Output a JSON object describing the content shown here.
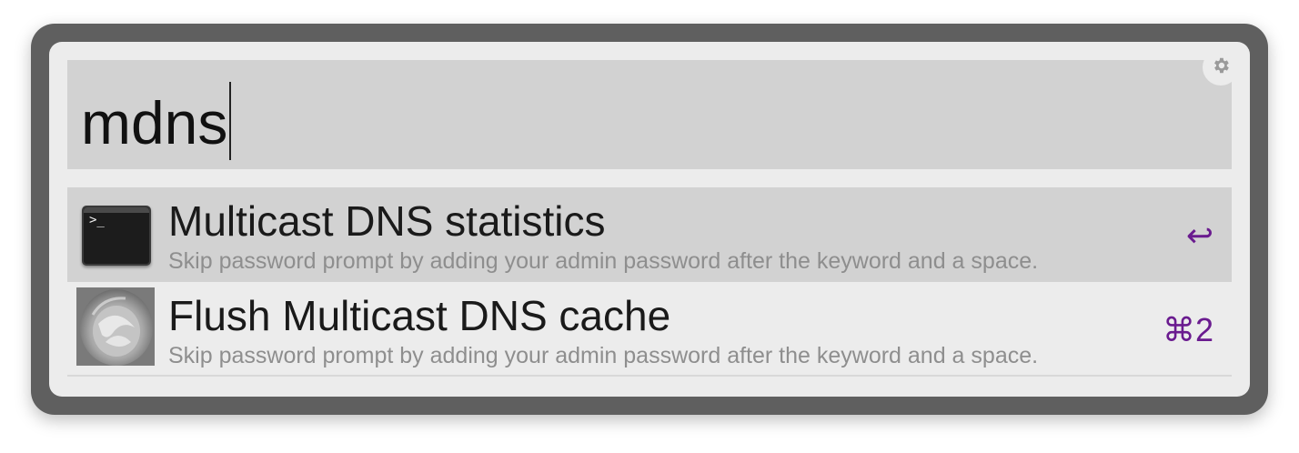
{
  "search": {
    "query": "mdns"
  },
  "settings": {
    "icon": "gear-icon"
  },
  "results": [
    {
      "title": "Multicast DNS statistics",
      "subtitle": "Skip password prompt by adding your admin password after the keyword and a space.",
      "shortcut": "↩",
      "icon": "terminal-icon",
      "selected": true
    },
    {
      "title": "Flush Multicast DNS cache",
      "subtitle": "Skip password prompt by adding your admin password after the keyword and a space.",
      "shortcut": "⌘2",
      "icon": "toilet-flush-icon",
      "selected": false
    }
  ],
  "colors": {
    "frame": "#5f5f5f",
    "panel": "#ececec",
    "highlight": "#d2d2d2",
    "shortcut": "#6a1b8f",
    "subtitle": "#8e8e8e"
  }
}
